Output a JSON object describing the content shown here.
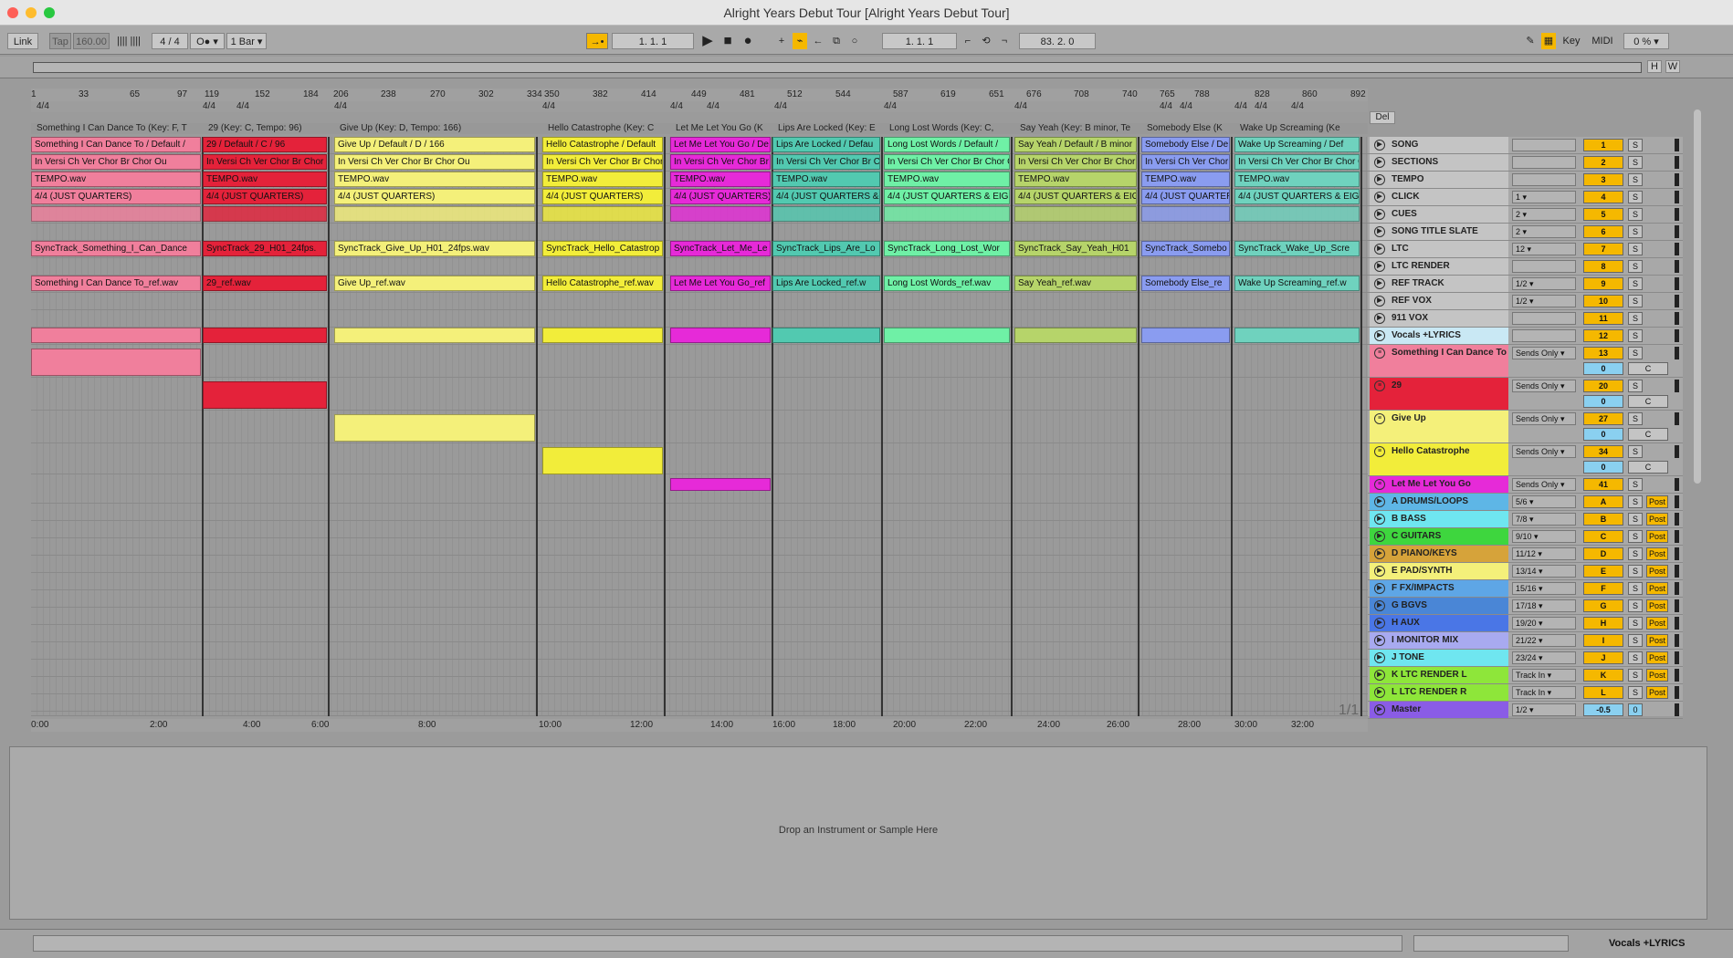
{
  "window": {
    "title": "Alright Years Debut Tour  [Alright Years Debut Tour]"
  },
  "toolbar": {
    "link": "Link",
    "tap": "Tap",
    "tempo": "160.00",
    "signature": "4 / 4",
    "metro_symbol": "O●",
    "quantize": "1 Bar",
    "position": "1.  1.  1",
    "loop_start": "1.  1.  1",
    "loop_length": "83.  2.  0",
    "key": "Key",
    "midi": "MIDI",
    "cpu": "0 %"
  },
  "overview": {
    "h": "H",
    "w": "W"
  },
  "ruler": {
    "ticks": [
      "1",
      "33",
      "65",
      "97",
      "119",
      "152",
      "184",
      "206",
      "238",
      "270",
      "302",
      "334",
      "350",
      "382",
      "414",
      "449",
      "481",
      "512",
      "544",
      "587",
      "619",
      "651",
      "676",
      "708",
      "740",
      "765",
      "788",
      "828",
      "860",
      "892"
    ]
  },
  "signatures": [
    "4/4",
    "4/4",
    "4/4",
    "4/4",
    "4/4",
    "4/4",
    "4/4",
    "4/4",
    "4/4",
    "4/4",
    "4/4",
    "4/4",
    "4/4",
    "4/4",
    "4/4"
  ],
  "locators": [
    "Something I Can Dance To (Key: F, T",
    "29 (Key: C, Tempo: 96)",
    "Give Up (Key: D, Tempo: 166)",
    "Hello Catastrophe (Key: C",
    "Let Me Let You Go (K",
    "Lips Are Locked (Key: E",
    "Long Lost Words (Key: C,",
    "Say Yeah (Key: B minor, Te",
    "Somebody Else (K",
    "Wake Up Screaming (Ke"
  ],
  "songs": [
    {
      "name": "Something I Can Dance To",
      "color": "#f07f9c",
      "section": "Something I Can Dance To / Default /",
      "sync": "SyncTrack_Something_I_Can_Dance",
      "ref": "Something I Can Dance To_ref.wav"
    },
    {
      "name": "29",
      "color": "#e4223a",
      "section": "29 / Default / C / 96",
      "sync": "SyncTrack_29_H01_24fps.",
      "ref": "29_ref.wav"
    },
    {
      "name": "Give Up",
      "color": "#f4f07a",
      "section": "Give Up / Default / D / 166",
      "sync": "SyncTrack_Give_Up_H01_24fps.wav",
      "ref": "Give Up_ref.wav"
    },
    {
      "name": "Hello Catastrophe",
      "color": "#f2ed3a",
      "section": "Hello Catastrophe / Default",
      "sync": "SyncTrack_Hello_Catastrop",
      "ref": "Hello Catastrophe_ref.wav"
    },
    {
      "name": "Let Me Let You Go",
      "color": "#e62ad8",
      "section": "Let Me Let You Go / De",
      "sync": "SyncTrack_Let_Me_Le",
      "ref": "Let Me Let You Go_ref"
    },
    {
      "name": "Lips Are Locked",
      "color": "#52c9b0",
      "section": "Lips Are Locked / Defau",
      "sync": "SyncTrack_Lips_Are_Lo",
      "ref": "Lips Are Locked_ref.w"
    },
    {
      "name": "Long Lost Words",
      "color": "#6ff0a6",
      "section": "Long Lost Words / Default /",
      "sync": "SyncTrack_Long_Lost_Wor",
      "ref": "Long Lost Words_ref.wav"
    },
    {
      "name": "Say Yeah",
      "color": "#b6d46a",
      "section": "Say Yeah / Default / B minor",
      "sync": "SyncTrack_Say_Yeah_H01",
      "ref": "Say Yeah_ref.wav"
    },
    {
      "name": "Somebody Else",
      "color": "#8a9cf0",
      "section": "Somebody Else / De",
      "sync": "SyncTrack_Somebo",
      "ref": "Somebody Else_re"
    },
    {
      "name": "Wake Up Screaming",
      "color": "#6fd2be",
      "section": "Wake Up Screaming / Def",
      "sync": "SyncTrack_Wake_Up_Scre",
      "ref": "Wake Up Screaming_ref.w"
    }
  ],
  "clip_text": {
    "tempo": "TEMPO.wav",
    "quarters": "4/4 (JUST QUARTERS)",
    "quarters_eighths": "4/4 (JUST QUARTERS & EIGH",
    "sections_fragment": "In Versi Ch Ver Chor Br Chor Ou"
  },
  "time_labels": [
    "0:00",
    "2:00",
    "4:00",
    "6:00",
    "8:00",
    "10:00",
    "12:00",
    "14:00",
    "16:00",
    "18:00",
    "20:00",
    "22:00",
    "24:00",
    "26:00",
    "28:00",
    "30:00",
    "32:00"
  ],
  "page_counter": "1/1",
  "mixer": {
    "del": "Del",
    "tracks": [
      {
        "name": "SONG",
        "io": "",
        "num": "1",
        "solo": "S",
        "color": "#c4c4c4"
      },
      {
        "name": "SECTIONS",
        "io": "",
        "num": "2",
        "solo": "S",
        "color": "#c4c4c4"
      },
      {
        "name": "TEMPO",
        "io": "",
        "num": "3",
        "solo": "S",
        "color": "#c4c4c4"
      },
      {
        "name": "CLICK",
        "io": "1",
        "num": "4",
        "solo": "S",
        "color": "#c4c4c4"
      },
      {
        "name": "CUES",
        "io": "2",
        "num": "5",
        "solo": "S",
        "color": "#c4c4c4"
      },
      {
        "name": "SONG TITLE SLATE",
        "io": "2",
        "num": "6",
        "solo": "S",
        "color": "#c4c4c4"
      },
      {
        "name": "LTC",
        "io": "12",
        "num": "7",
        "solo": "S",
        "color": "#c4c4c4"
      },
      {
        "name": "LTC RENDER",
        "io": "",
        "num": "8",
        "solo": "S",
        "color": "#c4c4c4"
      },
      {
        "name": "REF TRACK",
        "io": "1/2",
        "num": "9",
        "solo": "S",
        "color": "#c4c4c4"
      },
      {
        "name": "REF VOX",
        "io": "1/2",
        "num": "10",
        "solo": "S",
        "color": "#c4c4c4"
      },
      {
        "name": "911 VOX",
        "io": "",
        "num": "11",
        "solo": "S",
        "color": "#c4c4c4"
      },
      {
        "name": "Vocals +LYRICS",
        "io": "",
        "num": "12",
        "solo": "S",
        "color": "#c9e8f4"
      },
      {
        "name": "Something I Can Dance To",
        "io": "Sends Only",
        "num": "13",
        "solo": "S",
        "color": "#f07f9c"
      },
      {
        "name": "29",
        "io": "Sends Only",
        "num": "20",
        "solo": "S",
        "color": "#e4223a"
      },
      {
        "name": "Give Up",
        "io": "Sends Only",
        "num": "27",
        "solo": "S",
        "color": "#f4f07a"
      },
      {
        "name": "Hello Catastrophe",
        "io": "Sends Only",
        "num": "34",
        "solo": "S",
        "color": "#f2ed3a"
      },
      {
        "name": "Let Me Let You Go",
        "io": "Sends Only",
        "num": "41",
        "solo": "S",
        "color": "#e62ad8"
      },
      {
        "name": "A DRUMS/LOOPS",
        "io": "5/6",
        "num": "A",
        "solo": "S",
        "color": "#5eb6e6"
      },
      {
        "name": "B BASS",
        "io": "7/8",
        "num": "B",
        "solo": "S",
        "color": "#6fe6f0"
      },
      {
        "name": "C GUITARS",
        "io": "9/10",
        "num": "C",
        "solo": "S",
        "color": "#3ed63e"
      },
      {
        "name": "D PIANO/KEYS",
        "io": "11/12",
        "num": "D",
        "solo": "S",
        "color": "#d6a33a"
      },
      {
        "name": "E PAD/SYNTH",
        "io": "13/14",
        "num": "E",
        "solo": "S",
        "color": "#f4f07a"
      },
      {
        "name": "F FX/IMPACTS",
        "io": "15/16",
        "num": "F",
        "solo": "S",
        "color": "#5ea6e6"
      },
      {
        "name": "G BGVS",
        "io": "17/18",
        "num": "G",
        "solo": "S",
        "color": "#4a86d6"
      },
      {
        "name": "H AUX",
        "io": "19/20",
        "num": "H",
        "solo": "S",
        "color": "#4a76e6"
      },
      {
        "name": "I MONITOR MIX",
        "io": "21/22",
        "num": "I",
        "solo": "S",
        "color": "#a8aaf0"
      },
      {
        "name": "J TONE",
        "io": "23/24",
        "num": "J",
        "solo": "S",
        "color": "#6fe6f0"
      },
      {
        "name": "K LTC RENDER L",
        "io": "Track In",
        "num": "K",
        "solo": "S",
        "color": "#8ee63a"
      },
      {
        "name": "L LTC RENDER R",
        "io": "Track In",
        "num": "L",
        "solo": "S",
        "color": "#8ee63a"
      },
      {
        "name": "Master",
        "io": "1/2",
        "num": "-0.5",
        "solo": "0",
        "color": "#8a5ce6"
      }
    ],
    "post": "Post",
    "sends": "0",
    "sends_c": "C"
  },
  "detail": {
    "hint": "Drop an Instrument or Sample Here"
  },
  "status": {
    "selected_track": "Vocals +LYRICS"
  }
}
